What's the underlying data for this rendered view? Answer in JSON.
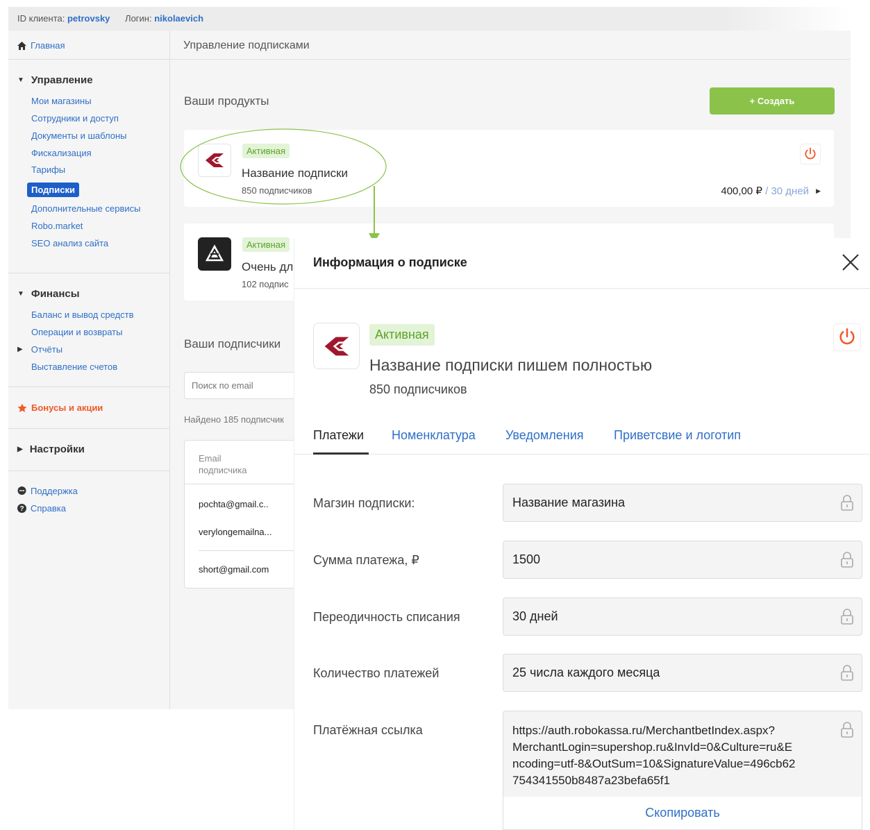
{
  "topbar": {
    "client_label": "ID клиента:",
    "client_value": "petrovsky",
    "login_label": "Логин:",
    "login_value": "nikolaevich"
  },
  "sidebar": {
    "home": "Главная",
    "section_manage": "Управление",
    "manage_items": [
      "Мои магазины",
      "Сотрудники и доступ",
      "Документы и шаблоны",
      "Фискализация",
      "Тарифы",
      "Подписки",
      "Дополнительные сервисы",
      "Robo.market",
      "SEO анализ сайта"
    ],
    "section_finance": "Финансы",
    "finance_items": [
      "Баланс и вывод средств",
      "Операции и возвраты",
      "Отчёты",
      "Выставление счетов"
    ],
    "bonuses": "Бонусы и акции",
    "settings": "Настройки",
    "support": "Поддержка",
    "help": "Справка"
  },
  "main": {
    "page_title": "Управление подписками",
    "products_title": "Ваши продукты",
    "create_button": "+ Создать",
    "product1": {
      "status": "Активная",
      "name": "Название подписки",
      "subscribers": "850 подписчиков",
      "price": "400,00 ₽",
      "period": " / 30 дней"
    },
    "product2": {
      "status": "Активная",
      "name": "Очень дл",
      "subscribers": "102 подпис"
    },
    "subscribers_title": "Ваши подписчики",
    "search_placeholder": "Поиск по email",
    "found_text": "Найдено 185 подписчик",
    "table_header": "Email подписчика",
    "rows": [
      "pochta@gmail.c..",
      "verylongemailna...",
      "short@gmail.com"
    ]
  },
  "panel": {
    "title": "Информация о подписке",
    "status": "Активная",
    "name": "Название подписки пишем полностью",
    "subscribers": "850 подписчиков",
    "tabs": [
      "Платежи",
      "Номенклатура",
      "Уведомления",
      "Приветсвие и логотип"
    ],
    "fields": [
      {
        "label": "Магзин подписки:",
        "value": "Название магазина"
      },
      {
        "label": "Сумма платежа, ₽",
        "value": "1500"
      },
      {
        "label": "Переодичность списания",
        "value": "30 дней"
      },
      {
        "label": "Количество платежей",
        "value": "25 числа каждого месяца"
      }
    ],
    "link_label": "Платёжная ссылка",
    "link_lines": [
      "https://auth.robokassa.ru/MerchantbetIndex.aspx?",
      "MerchantLogin=supershop.ru&InvId=0&Culture=ru&E",
      "ncoding=utf-8&OutSum=10&SignatureValue=496cb62",
      "754341550b8487a23befa65f1"
    ],
    "copy_button": "Скопировать"
  },
  "colors": {
    "accent": "#2f6fc7",
    "green": "#8bc34a",
    "power": "#f05a28",
    "annotation": "#8bc34a"
  }
}
